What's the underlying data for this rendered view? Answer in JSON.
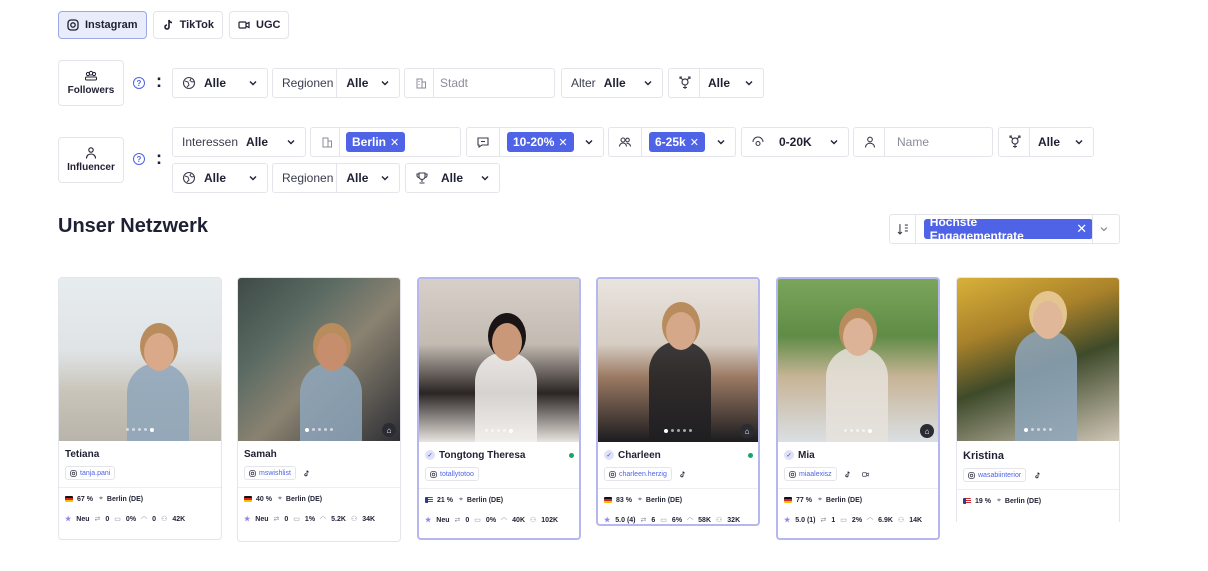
{
  "platform_tabs": [
    {
      "label": "Instagram",
      "icon": "instagram-icon",
      "active": true
    },
    {
      "label": "TikTok",
      "icon": "tiktok-icon",
      "active": false
    },
    {
      "label": "UGC",
      "icon": "video-icon",
      "active": false
    }
  ],
  "followers_row": {
    "type_label": "Followers",
    "country": {
      "value": "Alle"
    },
    "regions": {
      "label": "Regionen",
      "value": "Alle"
    },
    "city": {
      "placeholder": "Stadt"
    },
    "age": {
      "label": "Alter",
      "value": "Alle"
    },
    "gender": {
      "value": "Alle"
    }
  },
  "influencer_row": {
    "type_label": "Influencer",
    "interests": {
      "label": "Interessen",
      "value": "Alle"
    },
    "city_chip": "Berlin",
    "engagement_chip": "10-20%",
    "followers_chip": "6-25k",
    "reach": {
      "value": "0-20K"
    },
    "name": {
      "placeholder": "Name"
    },
    "gender": {
      "value": "Alle"
    },
    "country": {
      "value": "Alle"
    },
    "regions": {
      "label": "Regionen",
      "value": "Alle"
    },
    "award": {
      "value": "Alle"
    }
  },
  "network": {
    "title": "Unser Netzwerk",
    "sort_chip": "Höchste Engagementrate"
  },
  "cards": [
    {
      "name": "Tetiana",
      "handle": "tanja.pani",
      "verified": false,
      "online": false,
      "tiktok": false,
      "ugc": false,
      "flag": "de",
      "audience": "67 %",
      "location": "Berlin (DE)",
      "rating": "Neu",
      "s1": "0",
      "s2": "0%",
      "s3": "0",
      "s4": "42K"
    },
    {
      "name": "Samah",
      "handle": "mswishlist",
      "verified": false,
      "online": false,
      "tiktok": true,
      "ugc": false,
      "flag": "de",
      "audience": "40 %",
      "location": "Berlin (DE)",
      "rating": "Neu",
      "s1": "0",
      "s2": "1%",
      "s3": "5.2K",
      "s4": "34K"
    },
    {
      "name": "Tongtong Theresa",
      "handle": "totallytotoo",
      "verified": true,
      "online": true,
      "tiktok": false,
      "ugc": false,
      "flag": "us",
      "audience": "21 %",
      "location": "Berlin (DE)",
      "rating": "Neu",
      "s1": "0",
      "s2": "0%",
      "s3": "40K",
      "s4": "102K"
    },
    {
      "name": "Charleen",
      "handle": "charleen.herzig",
      "verified": true,
      "online": true,
      "tiktok": true,
      "ugc": false,
      "flag": "de",
      "audience": "83 %",
      "location": "Berlin (DE)",
      "rating": "5.0 (4)",
      "s1": "6",
      "s2": "6%",
      "s3": "58K",
      "s4": "32K"
    },
    {
      "name": "Mia",
      "handle": "miaalexisz",
      "verified": true,
      "online": false,
      "tiktok": true,
      "ugc": true,
      "flag": "de",
      "audience": "77 %",
      "location": "Berlin (DE)",
      "rating": "5.0 (1)",
      "s1": "1",
      "s2": "2%",
      "s3": "6.9K",
      "s4": "14K"
    },
    {
      "name": "Kristina",
      "handle": "wasabiinterior",
      "verified": false,
      "online": false,
      "tiktok": true,
      "ugc": false,
      "flag": "us",
      "audience": "19 %",
      "location": "Berlin (DE)"
    }
  ]
}
